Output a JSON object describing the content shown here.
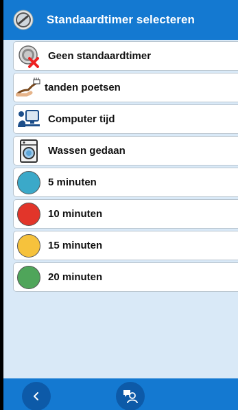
{
  "header": {
    "title": "Standaardtimer selecteren",
    "icon": "timer-icon"
  },
  "items": [
    {
      "label": "Geen standaardtimer",
      "icon": "no-timer-icon"
    },
    {
      "label": "tanden poetsen",
      "icon": "toothbrush-icon"
    },
    {
      "label": "Computer tijd",
      "icon": "computer-user-icon"
    },
    {
      "label": "Wassen gedaan",
      "icon": "washing-machine-icon"
    },
    {
      "label": "5 minuten",
      "icon": "circle-icon",
      "color": "#3ba9c9"
    },
    {
      "label": "10 minuten",
      "icon": "circle-icon",
      "color": "#e2352a"
    },
    {
      "label": "15 minuten",
      "icon": "circle-icon",
      "color": "#f6c23c"
    },
    {
      "label": "20 minuten",
      "icon": "circle-icon",
      "color": "#4fa55a"
    }
  ],
  "footer": {
    "back_icon": "chevron-left-icon",
    "user_icon": "user-chat-icon"
  },
  "colors": {
    "accent": "#1479d1",
    "accent_dark": "#0d5aa8",
    "background": "#d9e9f7"
  }
}
